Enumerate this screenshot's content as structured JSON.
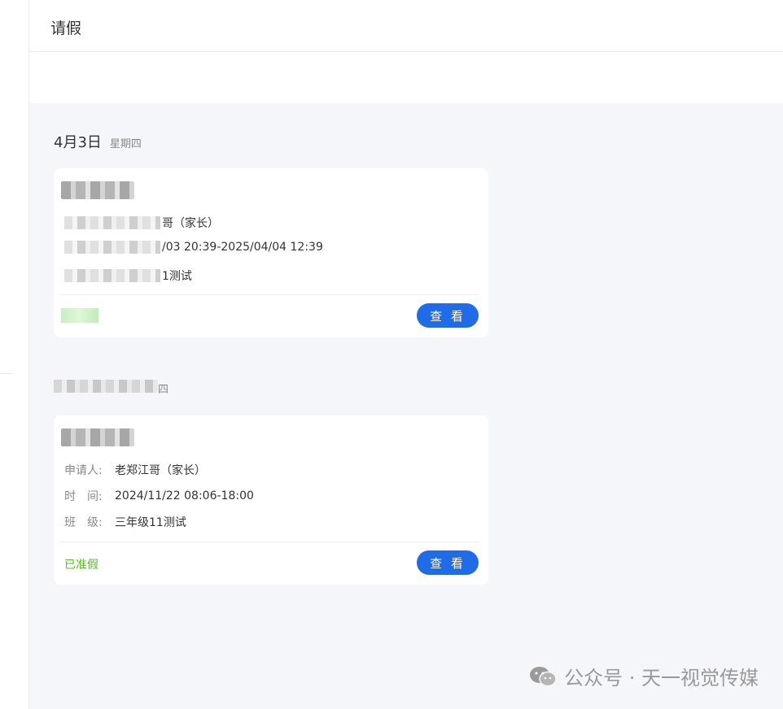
{
  "header": {
    "title": "请假"
  },
  "days": [
    {
      "date": "4月3日",
      "weekday": "星期四",
      "card": {
        "applicant_value": "哥（家长）",
        "time_value": "/03 20:39-2025/04/04 12:39",
        "class_value": "1测试",
        "view_label": "查 看"
      }
    },
    {
      "weekday": "四",
      "card": {
        "applicant_label": "申请人:",
        "applicant_value": "老郑江哥（家长）",
        "time_label": "时　间:",
        "time_value": "2024/11/22 08:06-18:00",
        "class_label": "班　级:",
        "class_value": "三年级11测试",
        "status": "已准假",
        "view_label": "查 看"
      }
    }
  ],
  "watermark": {
    "text": "公众号 · 天一视觉传媒",
    "icon": "wechat-icon"
  },
  "colors": {
    "accent": "#1f6ce6",
    "approved": "#52c41a",
    "background": "#f4f6f9"
  }
}
